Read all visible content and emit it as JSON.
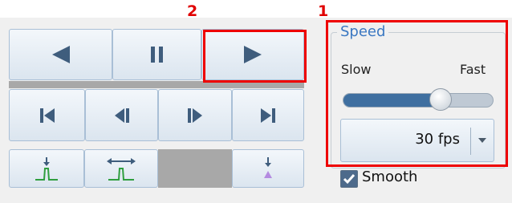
{
  "annotations": {
    "label_1": "1",
    "label_2": "2"
  },
  "playback": {
    "row1": [
      {
        "icon": "play-backward-icon"
      },
      {
        "icon": "pause-icon"
      },
      {
        "icon": "play-forward-icon"
      }
    ],
    "row2": [
      {
        "icon": "skip-to-start-icon"
      },
      {
        "icon": "step-backward-icon"
      },
      {
        "icon": "step-forward-icon"
      },
      {
        "icon": "skip-to-end-icon"
      }
    ],
    "row3": [
      {
        "icon": "single-peak-marker-icon"
      },
      {
        "icon": "range-peak-marker-icon"
      },
      {
        "icon": "triangle-marker-icon"
      }
    ]
  },
  "speed": {
    "title": "Speed",
    "slow_label": "Slow",
    "fast_label": "Fast",
    "slider_value_fraction": 0.65,
    "fps_value": "30 fps",
    "smooth_label": "Smooth",
    "smooth_checked": true
  },
  "colors": {
    "highlight": "#ee0000",
    "accent": "#3b78c2",
    "slider_fill": "#3f6fa0"
  }
}
